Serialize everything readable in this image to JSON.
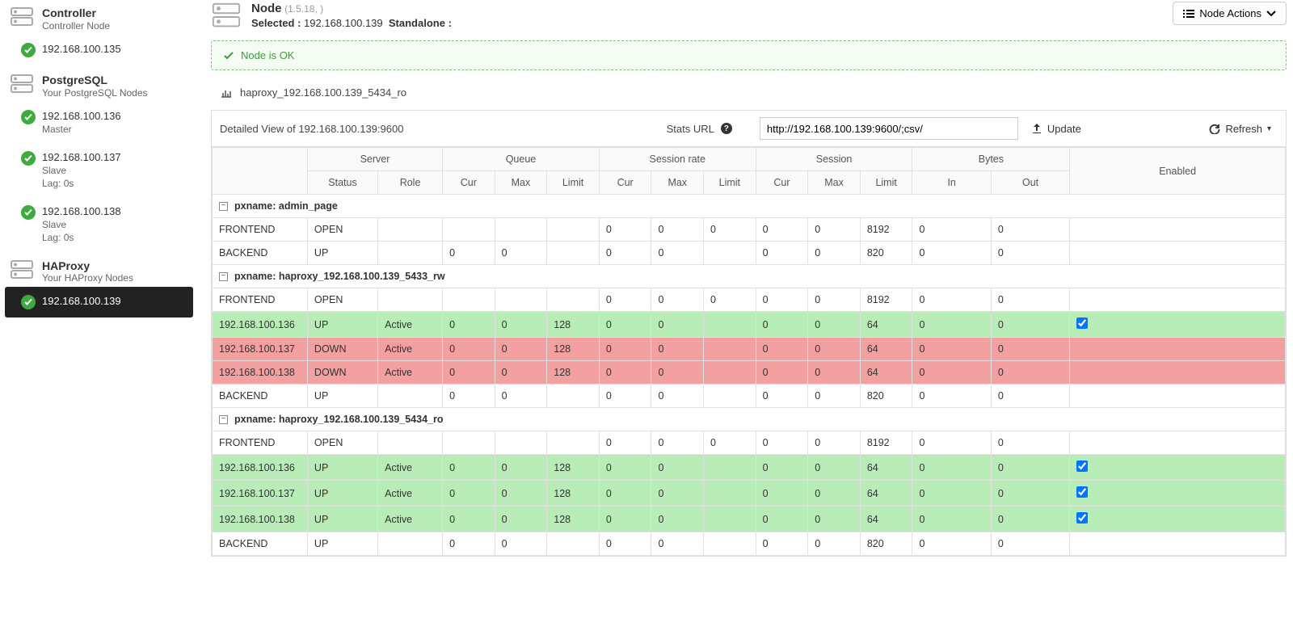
{
  "sidebar": {
    "groups": [
      {
        "title": "Controller",
        "subtitle": "Controller Node",
        "items": [
          {
            "label": "192.168.100.135",
            "meta": "",
            "lag": "",
            "active": false
          }
        ]
      },
      {
        "title": "PostgreSQL",
        "subtitle": "Your PostgreSQL Nodes",
        "items": [
          {
            "label": "192.168.100.136",
            "meta": "Master",
            "lag": "",
            "active": false
          },
          {
            "label": "192.168.100.137",
            "meta": "Slave",
            "lag": "Lag: 0s",
            "active": false
          },
          {
            "label": "192.168.100.138",
            "meta": "Slave",
            "lag": "Lag: 0s",
            "active": false
          }
        ]
      },
      {
        "title": "HAProxy",
        "subtitle": "Your HAProxy Nodes",
        "items": [
          {
            "label": "192.168.100.139",
            "meta": "",
            "lag": "",
            "active": true
          }
        ]
      }
    ]
  },
  "header": {
    "node_label": "Node",
    "version": "(1.5.18, )",
    "selected_label": "Selected :",
    "selected_ip": "192.168.100.139",
    "standalone_label": "Standalone :",
    "actions_label": "Node Actions"
  },
  "alert": {
    "text": "Node is OK"
  },
  "proxy_title": "haproxy_192.168.100.139_5434_ro",
  "panel": {
    "detail_label": "Detailed View of 192.168.100.139:9600",
    "stats_label": "Stats URL",
    "stats_url": "http://192.168.100.139:9600/;csv/",
    "update_label": "Update",
    "refresh_label": "Refresh"
  },
  "columns": {
    "server": "Server",
    "queue": "Queue",
    "srate": "Session rate",
    "session": "Session",
    "bytes": "Bytes",
    "enabled": "Enabled",
    "status": "Status",
    "role": "Role",
    "cur": "Cur",
    "max": "Max",
    "limit": "Limit",
    "in": "In",
    "out": "Out"
  },
  "groupsData": [
    {
      "name": "pxname: admin_page",
      "rows": [
        {
          "name": "FRONTEND",
          "status": "OPEN",
          "role": "",
          "qcur": "",
          "qmax": "",
          "qlim": "",
          "srcur": "0",
          "srmax": "0",
          "srlim": "0",
          "scur": "0",
          "smax": "0",
          "slim": "8192",
          "bin": "0",
          "bout": "0",
          "enabled": null,
          "cls": ""
        },
        {
          "name": "BACKEND",
          "status": "UP",
          "role": "",
          "qcur": "0",
          "qmax": "0",
          "qlim": "",
          "srcur": "0",
          "srmax": "0",
          "srlim": "",
          "scur": "0",
          "smax": "0",
          "slim": "820",
          "bin": "0",
          "bout": "0",
          "enabled": null,
          "cls": ""
        }
      ]
    },
    {
      "name": "pxname: haproxy_192.168.100.139_5433_rw",
      "rows": [
        {
          "name": "FRONTEND",
          "status": "OPEN",
          "role": "",
          "qcur": "",
          "qmax": "",
          "qlim": "",
          "srcur": "0",
          "srmax": "0",
          "srlim": "0",
          "scur": "0",
          "smax": "0",
          "slim": "8192",
          "bin": "0",
          "bout": "0",
          "enabled": null,
          "cls": ""
        },
        {
          "name": "192.168.100.136",
          "status": "UP",
          "role": "Active",
          "qcur": "0",
          "qmax": "0",
          "qlim": "128",
          "srcur": "0",
          "srmax": "0",
          "srlim": "",
          "scur": "0",
          "smax": "0",
          "slim": "64",
          "bin": "0",
          "bout": "0",
          "enabled": true,
          "cls": "row-green"
        },
        {
          "name": "192.168.100.137",
          "status": "DOWN",
          "role": "Active",
          "qcur": "0",
          "qmax": "0",
          "qlim": "128",
          "srcur": "0",
          "srmax": "0",
          "srlim": "",
          "scur": "0",
          "smax": "0",
          "slim": "64",
          "bin": "0",
          "bout": "0",
          "enabled": false,
          "cls": "row-red"
        },
        {
          "name": "192.168.100.138",
          "status": "DOWN",
          "role": "Active",
          "qcur": "0",
          "qmax": "0",
          "qlim": "128",
          "srcur": "0",
          "srmax": "0",
          "srlim": "",
          "scur": "0",
          "smax": "0",
          "slim": "64",
          "bin": "0",
          "bout": "0",
          "enabled": false,
          "cls": "row-red"
        },
        {
          "name": "BACKEND",
          "status": "UP",
          "role": "",
          "qcur": "0",
          "qmax": "0",
          "qlim": "",
          "srcur": "0",
          "srmax": "0",
          "srlim": "",
          "scur": "0",
          "smax": "0",
          "slim": "820",
          "bin": "0",
          "bout": "0",
          "enabled": null,
          "cls": ""
        }
      ]
    },
    {
      "name": "pxname: haproxy_192.168.100.139_5434_ro",
      "rows": [
        {
          "name": "FRONTEND",
          "status": "OPEN",
          "role": "",
          "qcur": "",
          "qmax": "",
          "qlim": "",
          "srcur": "0",
          "srmax": "0",
          "srlim": "0",
          "scur": "0",
          "smax": "0",
          "slim": "8192",
          "bin": "0",
          "bout": "0",
          "enabled": null,
          "cls": ""
        },
        {
          "name": "192.168.100.136",
          "status": "UP",
          "role": "Active",
          "qcur": "0",
          "qmax": "0",
          "qlim": "128",
          "srcur": "0",
          "srmax": "0",
          "srlim": "",
          "scur": "0",
          "smax": "0",
          "slim": "64",
          "bin": "0",
          "bout": "0",
          "enabled": true,
          "cls": "row-green"
        },
        {
          "name": "192.168.100.137",
          "status": "UP",
          "role": "Active",
          "qcur": "0",
          "qmax": "0",
          "qlim": "128",
          "srcur": "0",
          "srmax": "0",
          "srlim": "",
          "scur": "0",
          "smax": "0",
          "slim": "64",
          "bin": "0",
          "bout": "0",
          "enabled": true,
          "cls": "row-green"
        },
        {
          "name": "192.168.100.138",
          "status": "UP",
          "role": "Active",
          "qcur": "0",
          "qmax": "0",
          "qlim": "128",
          "srcur": "0",
          "srmax": "0",
          "srlim": "",
          "scur": "0",
          "smax": "0",
          "slim": "64",
          "bin": "0",
          "bout": "0",
          "enabled": true,
          "cls": "row-green"
        },
        {
          "name": "BACKEND",
          "status": "UP",
          "role": "",
          "qcur": "0",
          "qmax": "0",
          "qlim": "",
          "srcur": "0",
          "srmax": "0",
          "srlim": "",
          "scur": "0",
          "smax": "0",
          "slim": "820",
          "bin": "0",
          "bout": "0",
          "enabled": null,
          "cls": ""
        }
      ]
    }
  ]
}
